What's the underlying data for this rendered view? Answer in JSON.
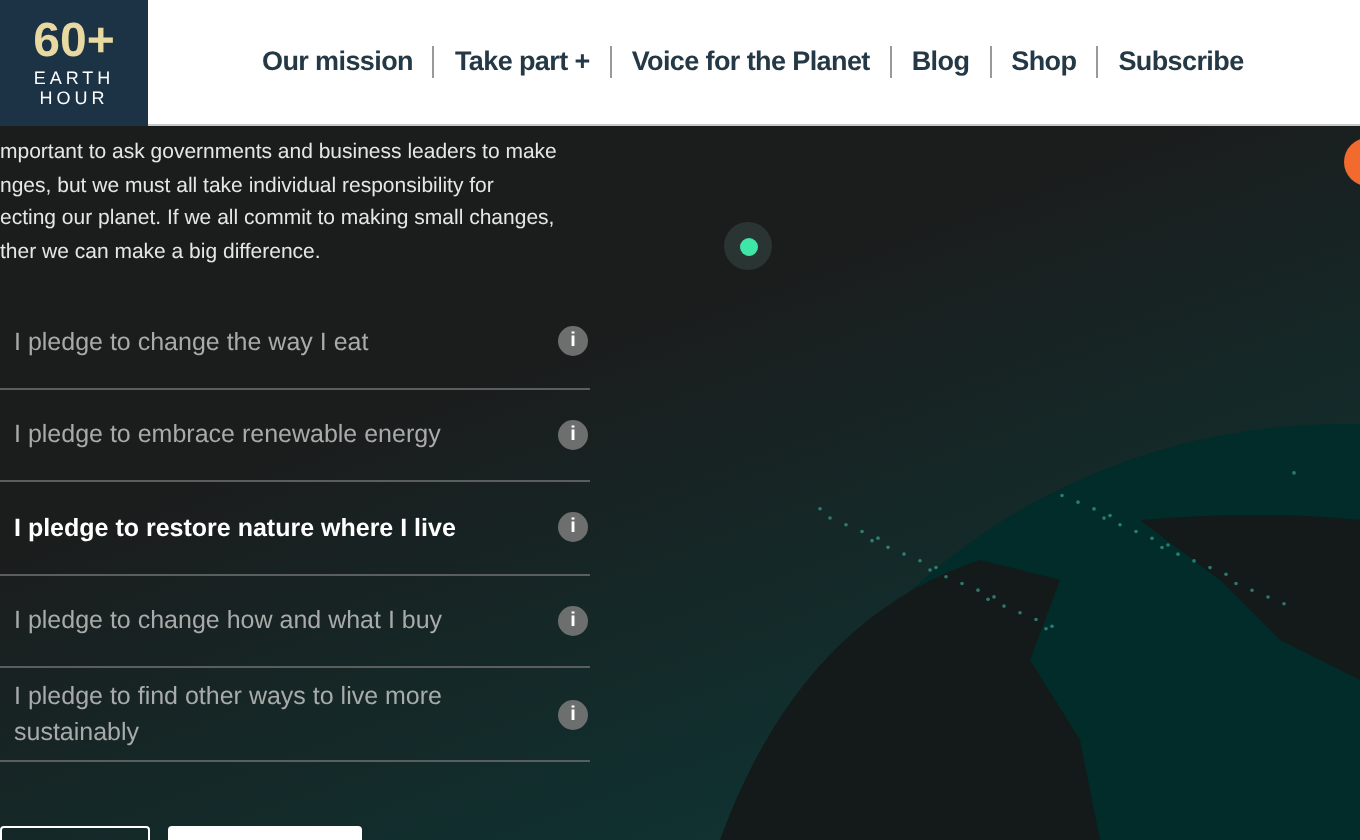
{
  "logo": {
    "number": "60+",
    "line_1": "EARTH",
    "line_2": "HOUR"
  },
  "nav": [
    "Our mission",
    "Take part +",
    "Voice for the Planet",
    "Blog",
    "Shop",
    "Subscribe"
  ],
  "intro": {
    "lines": [
      "mportant to ask governments and business leaders to make",
      "nges, but we must all take individual responsibility for",
      "ecting our planet. If we all commit to making small changes,",
      "ther we can make a big difference."
    ]
  },
  "pledges": [
    {
      "label": "I pledge to change the way I eat",
      "selected": false,
      "info": "i"
    },
    {
      "label": "I pledge to embrace renewable energy",
      "selected": false,
      "info": "i"
    },
    {
      "label": "I pledge to restore nature where I live",
      "selected": true,
      "info": "i"
    },
    {
      "label": "I pledge to change how and what I buy",
      "selected": false,
      "info": "i"
    },
    {
      "label": "I pledge to find other ways to live more sustainably",
      "selected": false,
      "info": "i"
    }
  ],
  "buttons": [
    {
      "kind": "outline"
    },
    {
      "kind": "solid"
    }
  ]
}
